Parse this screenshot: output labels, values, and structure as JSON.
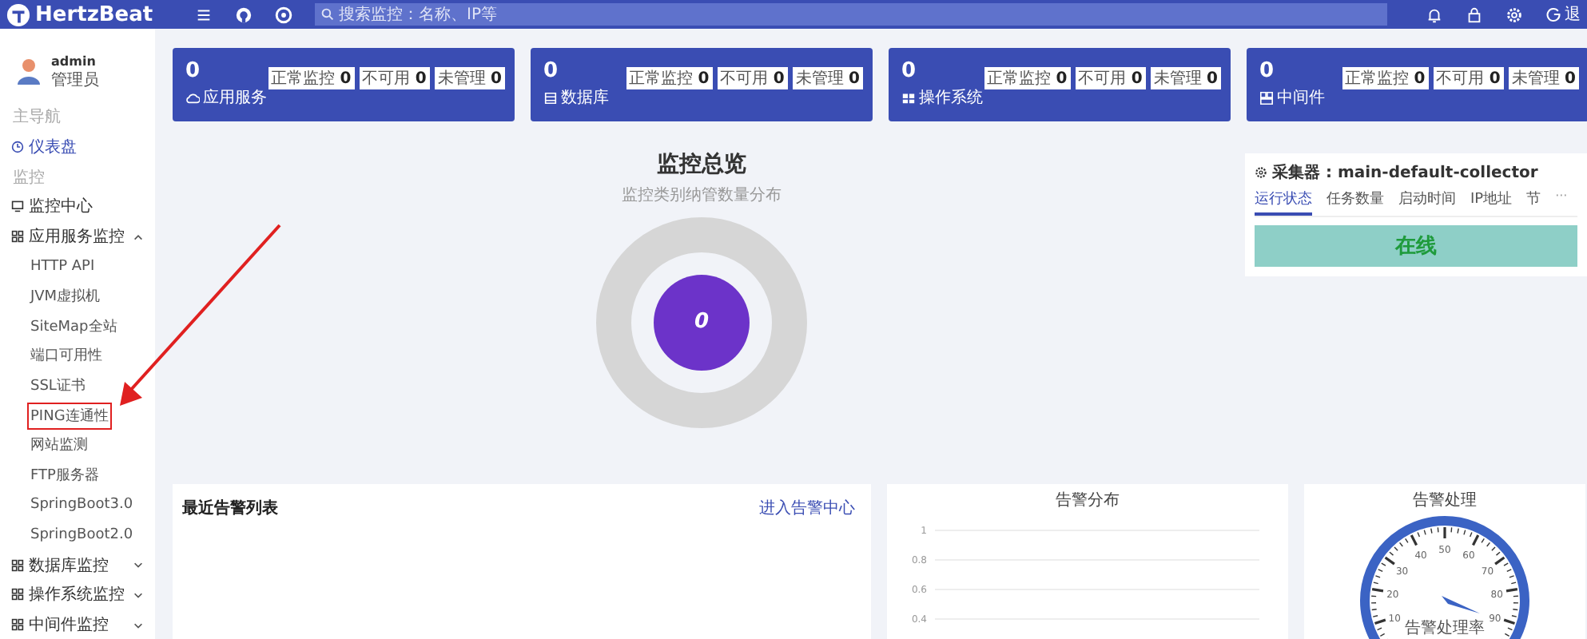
{
  "header": {
    "logo": "HertzBeat",
    "search": {
      "placeholder": "搜索监控：名称、IP等"
    },
    "user_menu": "退"
  },
  "user": {
    "name": "admin",
    "role": "管理员"
  },
  "sidebar": [
    {
      "kind": "heading",
      "label": "主导航"
    },
    {
      "kind": "item",
      "label": "仪表盘",
      "selected": true
    },
    {
      "kind": "heading",
      "label": "监控"
    },
    {
      "kind": "item",
      "label": "监控中心",
      "selected": false
    },
    {
      "kind": "group",
      "label": "应用服务监控",
      "expanded": true,
      "children": [
        {
          "label": "HTTP API",
          "annotated": false
        },
        {
          "label": "JVM虚拟机",
          "annotated": false
        },
        {
          "label": "SiteMap全站",
          "annotated": false
        },
        {
          "label": "端口可用性",
          "annotated": false
        },
        {
          "label": "SSL证书",
          "annotated": false
        },
        {
          "label": "PING连通性",
          "annotated": true
        },
        {
          "label": "网站监测",
          "annotated": false
        },
        {
          "label": "FTP服务器",
          "annotated": false
        },
        {
          "label": "SpringBoot3.0",
          "annotated": false
        },
        {
          "label": "SpringBoot2.0",
          "annotated": false
        }
      ]
    },
    {
      "kind": "group",
      "label": "数据库监控",
      "expanded": false
    },
    {
      "kind": "group",
      "label": "操作系统监控",
      "expanded": false
    },
    {
      "kind": "group",
      "label": "中间件监控",
      "expanded": false
    }
  ],
  "summary_cards": [
    {
      "value": "0",
      "label": "应用服务",
      "tags": [
        {
          "label": "正常监控",
          "count": "0"
        },
        {
          "label": "不可用",
          "count": "0"
        },
        {
          "label": "未管理",
          "count": "0"
        }
      ]
    },
    {
      "value": "0",
      "label": "数据库",
      "tags": [
        {
          "label": "正常监控",
          "count": "0"
        },
        {
          "label": "不可用",
          "count": "0"
        },
        {
          "label": "未管理",
          "count": "0"
        }
      ]
    },
    {
      "value": "0",
      "label": "操作系统",
      "tags": [
        {
          "label": "正常监控",
          "count": "0"
        },
        {
          "label": "不可用",
          "count": "0"
        },
        {
          "label": "未管理",
          "count": "0"
        }
      ]
    },
    {
      "value": "0",
      "label": "中间件",
      "tags": [
        {
          "label": "正常监控",
          "count": "0"
        },
        {
          "label": "不可用",
          "count": "0"
        },
        {
          "label": "未管理",
          "count": "0"
        }
      ]
    }
  ],
  "overview": {
    "title": "监控总览",
    "subtitle": "监控类别纳管数量分布",
    "total": "0"
  },
  "collector": {
    "title": "采集器 : main-default-collector",
    "tabs": [
      {
        "label": "运行状态",
        "selected": true
      },
      {
        "label": "任务数量",
        "selected": false
      },
      {
        "label": "启动时间",
        "selected": false
      },
      {
        "label": "IP地址",
        "selected": false
      },
      {
        "label": "节",
        "selected": false
      }
    ],
    "more": "···",
    "status": "在线"
  },
  "alert_list": {
    "title": "最近告警列表",
    "link": "进入告警中心"
  },
  "alert_distribution": {
    "title": "告警分布",
    "axis_labels": [
      "1",
      "0.8",
      "0.6",
      "0.4"
    ]
  },
  "alert_handling": {
    "title": "告警处理",
    "gauge_labels": [
      "10",
      "20",
      "30",
      "40",
      "50",
      "60",
      "70",
      "80",
      "90"
    ],
    "gauge_caption": "告警处理率"
  }
}
